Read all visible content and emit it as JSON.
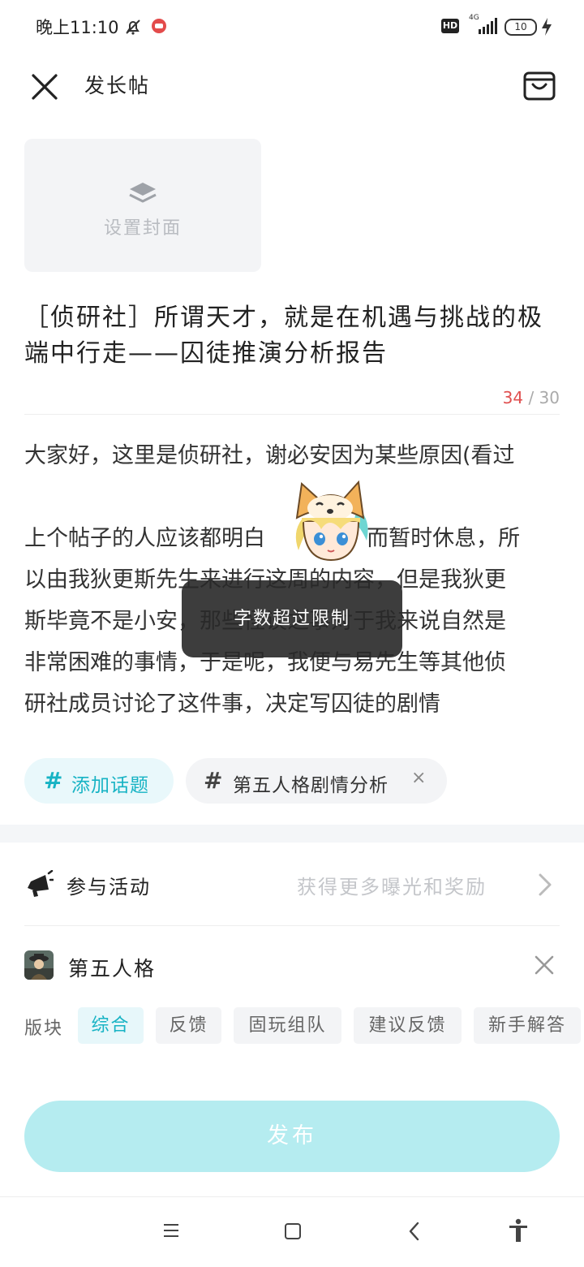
{
  "status_bar": {
    "time": "晚上11:10",
    "network_badge": "HD",
    "network_type": "4G",
    "battery": "10"
  },
  "header": {
    "title": "发长帖",
    "icons": [
      "close-icon",
      "drafts-bag-icon"
    ]
  },
  "cover": {
    "label": "设置封面",
    "icon": "layers-icon"
  },
  "post_title": {
    "text": "［侦研社］所谓天才，就是在机遇与挑战的极端中行走——囚徒推演分析报告",
    "count_current": "34",
    "count_limit": " / 30"
  },
  "body": {
    "lines": [
      "大家好，这里是侦研社，谢必安因为某些原因(看过",
      "",
      "上个帖子的人应该都明白 　　　　 而暂时休息，所",
      "以由我狄更斯先生来进行这周的内容，但是我狄更",
      "斯毕竟不是小安，那些怪谈之事对于我来说自然是",
      "非常困难的事情，于是呢，我便与易先生等其他侦",
      "研社成员讨论了这件事，决定写囚徒的剧情"
    ]
  },
  "toast": {
    "message": "字数超过限制"
  },
  "topics": {
    "add_label": "添加话题",
    "selected": "第五人格剧情分析",
    "hash_symbol": "#",
    "remove_symbol": "×"
  },
  "activity": {
    "label": "参与活动",
    "hint": "获得更多曝光和奖励"
  },
  "game": {
    "name": "第五人格"
  },
  "sections": {
    "label": "版块",
    "items": [
      "综合",
      "反馈",
      "固玩组队",
      "建议反馈",
      "新手解答"
    ],
    "active_index": 0
  },
  "publish": {
    "label": "发布"
  },
  "colors": {
    "accent": "#17b3c4",
    "publish_bg": "#b5ecf0",
    "over_limit": "#e05050",
    "chip_bg": "#f3f4f6"
  },
  "nav_bar": {
    "icons": [
      "menu-icon",
      "home-square-icon",
      "back-icon",
      "accessibility-icon"
    ]
  }
}
